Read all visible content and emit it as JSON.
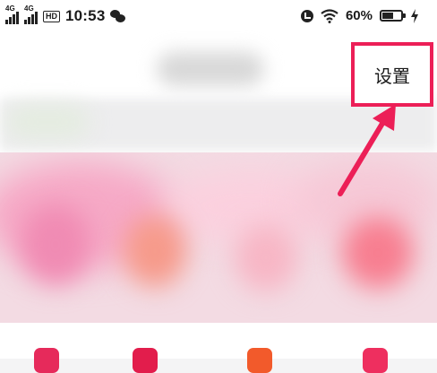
{
  "status_bar": {
    "sim1_network": "4G",
    "sim2_network": "4G",
    "hd_badge": "HD",
    "time": "10:53",
    "battery_percent": "60%",
    "battery_level": 0.6,
    "icons": [
      "signal-icon",
      "hd-icon",
      "wechat-icon",
      "alarm-icon",
      "wifi-icon",
      "battery-icon",
      "charging-icon"
    ]
  },
  "header": {
    "settings_label": "设置"
  },
  "annotation": {
    "highlight_color": "#ec1f57",
    "arrow_color": "#ec1f57"
  },
  "colors": {
    "accent": "#ec1f57",
    "banner_background": "#f3dbe3"
  }
}
